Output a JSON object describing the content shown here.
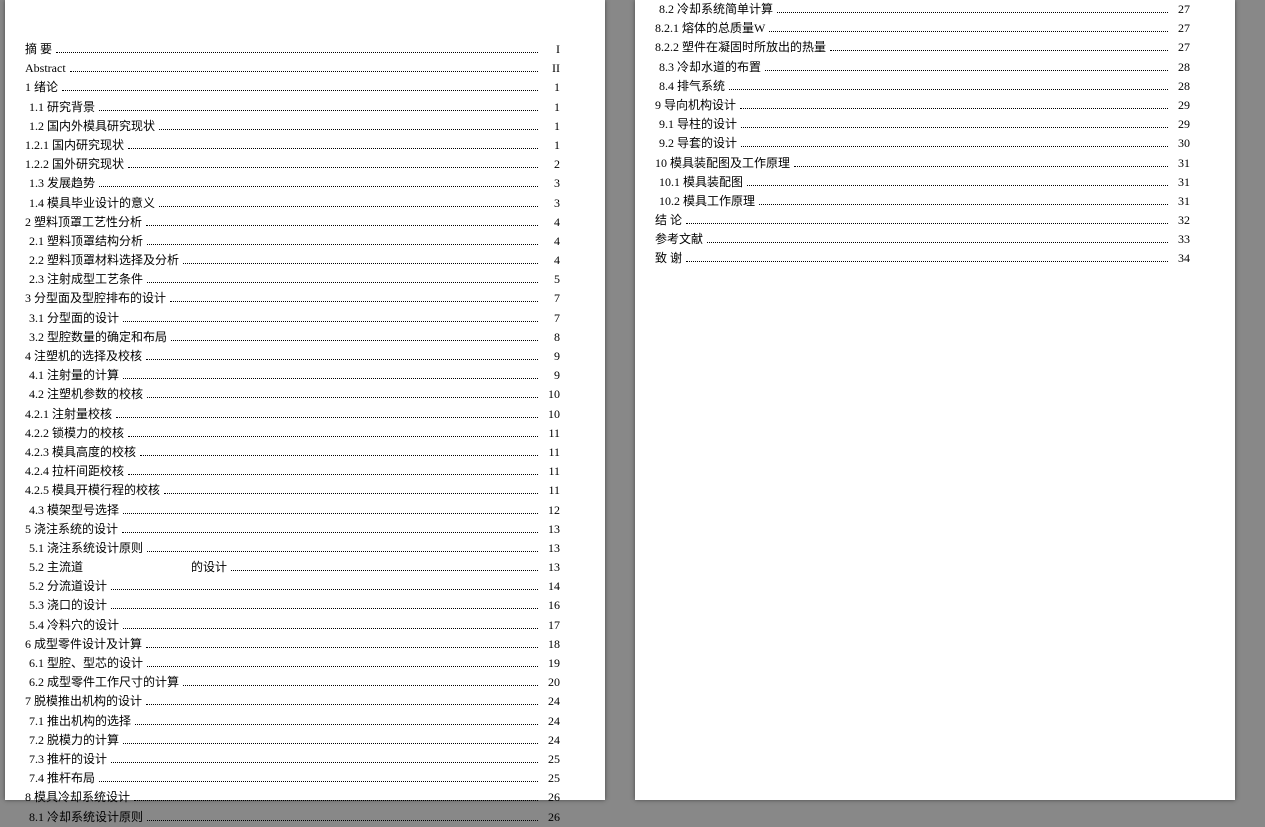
{
  "toc_left": [
    {
      "label": "摘 要",
      "page": "I",
      "indent": 0
    },
    {
      "label": "Abstract",
      "page": "II",
      "indent": 0
    },
    {
      "label": "1  绪论",
      "page": "1",
      "indent": 0
    },
    {
      "label": "1.1  研究背景",
      "page": "1",
      "indent": 1
    },
    {
      "label": "1.2  国内外模具研究现状",
      "page": "1",
      "indent": 1
    },
    {
      "label": "1.2.1 国内研究现状",
      "page": "1",
      "indent": 2
    },
    {
      "label": "1.2.2 国外研究现状",
      "page": "2",
      "indent": 2
    },
    {
      "label": "1.3  发展趋势",
      "page": "3",
      "indent": 1
    },
    {
      "label": "1.4  模具毕业设计的意义",
      "page": "3",
      "indent": 1
    },
    {
      "label": "2  塑料顶罩工艺性分析",
      "page": "4",
      "indent": 0
    },
    {
      "label": "2.1  塑料顶罩结构分析",
      "page": "4",
      "indent": 1
    },
    {
      "label": "2.2  塑料顶罩材料选择及分析",
      "page": "4",
      "indent": 1
    },
    {
      "label": "2.3  注射成型工艺条件",
      "page": "5",
      "indent": 1
    },
    {
      "label": "3  分型面及型腔排布的设计",
      "page": "7",
      "indent": 0
    },
    {
      "label": "3.1  分型面的设计",
      "page": "7",
      "indent": 1
    },
    {
      "label": "3.2  型腔数量的确定和布局",
      "page": "8",
      "indent": 1
    },
    {
      "label": "4  注塑机的选择及校核",
      "page": "9",
      "indent": 0
    },
    {
      "label": "4.1  注射量的计算",
      "page": "9",
      "indent": 1
    },
    {
      "label": "4.2  注塑机参数的校核",
      "page": "10",
      "indent": 1
    },
    {
      "label": "4.2.1 注射量校核",
      "page": "10",
      "indent": 2
    },
    {
      "label": "4.2.2 锁模力的校核",
      "page": "11",
      "indent": 2
    },
    {
      "label": "4.2.3 模具高度的校核",
      "page": "11",
      "indent": 2
    },
    {
      "label": "4.2.4 拉杆间距校核",
      "page": "11",
      "indent": 2
    },
    {
      "label": "4.2.5 模具开模行程的校核",
      "page": "11",
      "indent": 2
    },
    {
      "label": "4.3  模架型号选择",
      "page": "12",
      "indent": 1
    },
    {
      "label": "5  浇注系统的设计",
      "page": "13",
      "indent": 0
    },
    {
      "label": "5.1  浇注系统设计原则",
      "page": "13",
      "indent": 1
    },
    {
      "label": "5.2  主流道　　　　　　　　　的设计",
      "page": "13",
      "indent": 1
    },
    {
      "label": "5.2  分流道设计",
      "page": "14",
      "indent": 1
    },
    {
      "label": "5.3  浇口的设计",
      "page": "16",
      "indent": 1
    },
    {
      "label": "5.4  冷料穴的设计",
      "page": "17",
      "indent": 1
    },
    {
      "label": "6  成型零件设计及计算",
      "page": "18",
      "indent": 0
    },
    {
      "label": "6.1  型腔、型芯的设计",
      "page": "19",
      "indent": 1
    },
    {
      "label": "6.2  成型零件工作尺寸的计算",
      "page": "20",
      "indent": 1
    },
    {
      "label": "7  脱模推出机构的设计",
      "page": "24",
      "indent": 0
    },
    {
      "label": "7.1  推出机构的选择",
      "page": "24",
      "indent": 1
    },
    {
      "label": "7.2  脱模力的计算",
      "page": "24",
      "indent": 1
    },
    {
      "label": "7.3  推杆的设计",
      "page": "25",
      "indent": 1
    },
    {
      "label": "7.4  推杆布局",
      "page": "25",
      "indent": 1
    },
    {
      "label": "8  模具冷却系统设计",
      "page": "26",
      "indent": 0
    },
    {
      "label": "8.1  冷却系统设计原则",
      "page": "26",
      "indent": 1
    }
  ],
  "toc_right": [
    {
      "label": "8.2  冷却系统简单计算",
      "page": "27",
      "indent": 1
    },
    {
      "label": "8.2.1  熔体的总质量W",
      "page": "27",
      "indent": 2
    },
    {
      "label": "8.2.2  塑件在凝固时所放出的热量",
      "page": "27",
      "indent": 2
    },
    {
      "label": "8.3  冷却水道的布置",
      "page": "28",
      "indent": 1
    },
    {
      "label": "8.4  排气系统",
      "page": "28",
      "indent": 1
    },
    {
      "label": "9  导向机构设计",
      "page": "29",
      "indent": 0
    },
    {
      "label": "9.1  导柱的设计",
      "page": "29",
      "indent": 1
    },
    {
      "label": "9.2  导套的设计",
      "page": "30",
      "indent": 1
    },
    {
      "label": "10 模具装配图及工作原理",
      "page": "31",
      "indent": 0
    },
    {
      "label": "10.1  模具装配图",
      "page": "31",
      "indent": 1
    },
    {
      "label": "10.2  模具工作原理",
      "page": "31",
      "indent": 1
    },
    {
      "label": "结  论",
      "page": "32",
      "indent": 0
    },
    {
      "label": "参考文献",
      "page": "33",
      "indent": 0
    },
    {
      "label": "致  谢",
      "page": "34",
      "indent": 0
    }
  ]
}
